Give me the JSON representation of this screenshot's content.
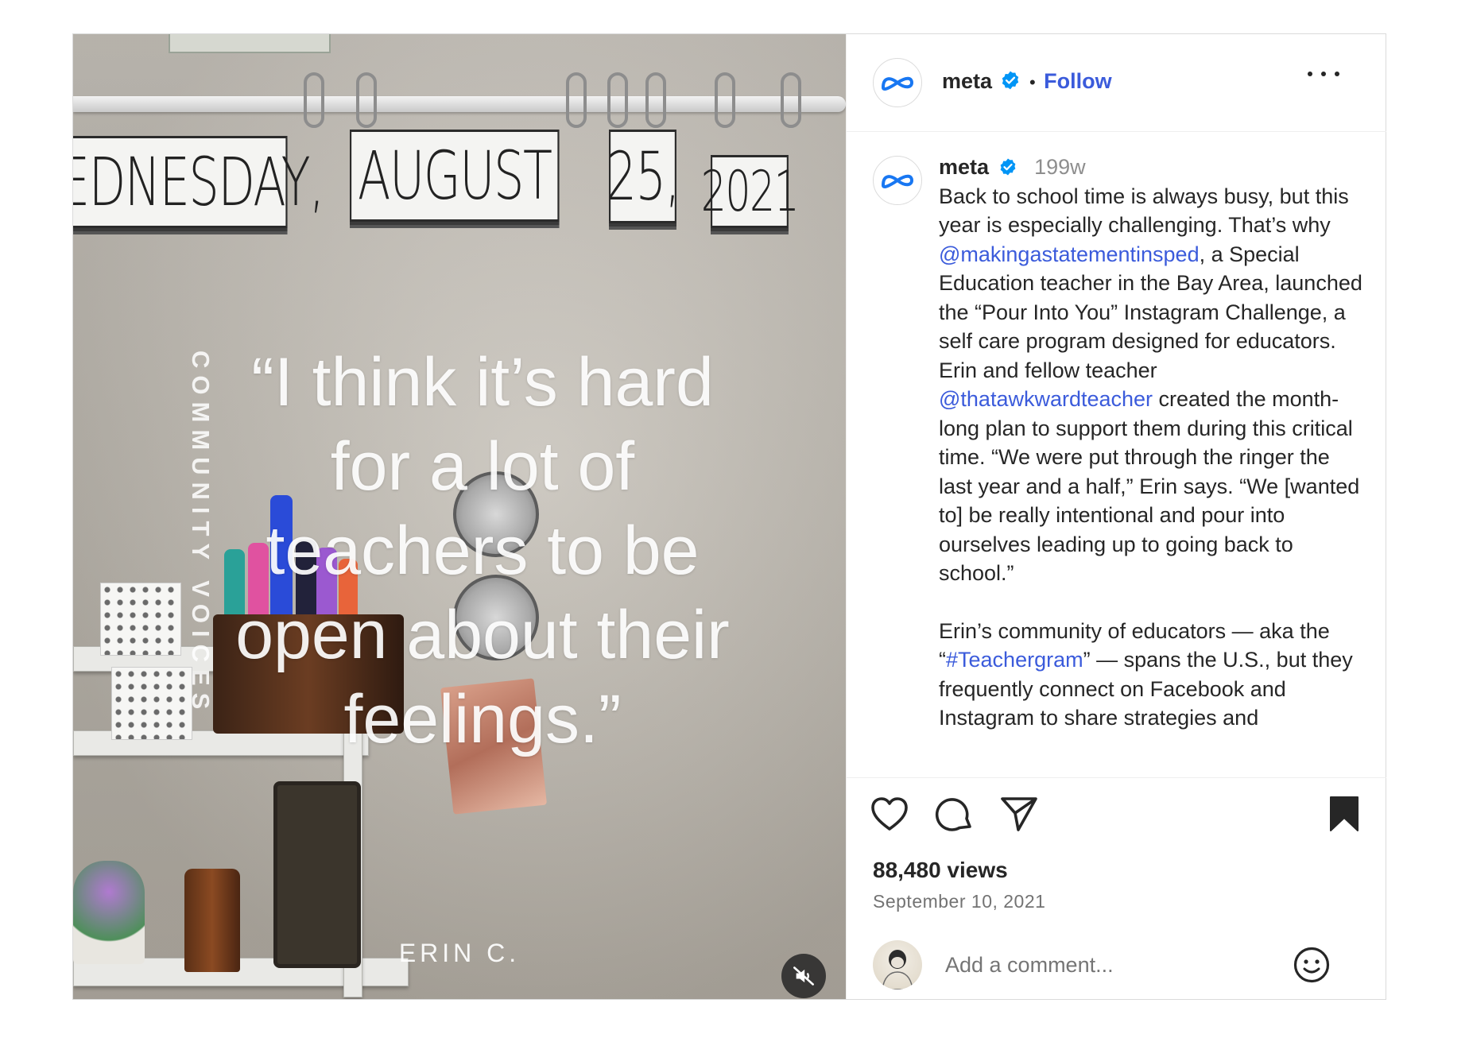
{
  "media": {
    "calendar": {
      "day": "WEDNESDAY,",
      "month": "AUGUST",
      "date": "25,",
      "year": "2021"
    },
    "side_label": "COMMUNITY VOICES",
    "quote": "“I think it’s hard for a lot of teachers to be open about their feelings.”",
    "author": "ERIN C.",
    "mute_icon": "speaker-muted-icon"
  },
  "header": {
    "username": "meta",
    "separator": "•",
    "follow_label": "Follow",
    "more_icon": "more-options-icon"
  },
  "caption": {
    "username": "meta",
    "time": "199w",
    "p1_a": "Back to school time is always busy, but this year is especially challenging. That’s why ",
    "mention1": "@makingastatementinsped",
    "p1_b": ", a Special Education teacher in the Bay Area, launched the “Pour Into You” Instagram Challenge, a self care program designed for educators. Erin and fellow teacher ",
    "mention2": "@thatawkwardteacher",
    "p1_c": " created the month-long plan to support them during this critical time. “We were put through the ringer the last year and a half,” Erin says. “We [wanted to] be really intentional and pour into ourselves leading up to going back to school.”",
    "p2_a": "Erin’s community of educators — aka the “",
    "hashtag": "#Teachergram",
    "p2_b": "” — spans the U.S., but they  frequently connect on Facebook and Instagram to share strategies and"
  },
  "actions": {
    "icons": [
      "heart-icon",
      "comment-icon",
      "share-icon",
      "bookmark-icon"
    ],
    "views": "88,480 views",
    "date": "September 10, 2021"
  },
  "comment": {
    "placeholder": "Add a comment...",
    "emoji_icon": "smiley-icon"
  },
  "colors": {
    "link": "#3b5bdb",
    "verified": "#0095f6",
    "muted_text": "#8e8e8e"
  }
}
